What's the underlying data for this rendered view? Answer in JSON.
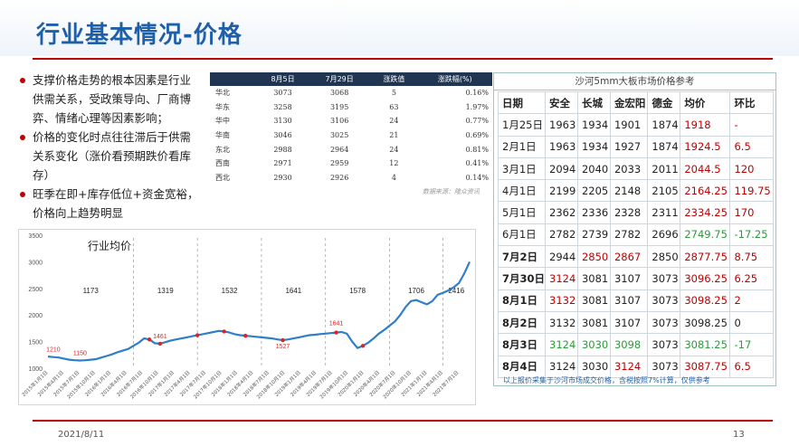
{
  "title": "行业基本情况-价格",
  "bullets": [
    "支撑价格走势的根本因素是行业供需关系，受政策导向、厂商博弈、情绪心理等因素影响；",
    "价格的变化时点往往滞后于供需关系变化（涨价看预期跌价看库存）",
    "旺季在即+库存低位+资金宽裕，价格向上趋势明显"
  ],
  "regional": {
    "headers": [
      "",
      "8月5日",
      "7月29日",
      "涨跌值",
      "涨跌幅(%)"
    ],
    "rows": [
      [
        "华北",
        "3073",
        "3068",
        "5",
        "0.16%"
      ],
      [
        "华东",
        "3258",
        "3195",
        "63",
        "1.97%"
      ],
      [
        "华中",
        "3130",
        "3106",
        "24",
        "0.77%"
      ],
      [
        "华南",
        "3046",
        "3025",
        "21",
        "0.69%"
      ],
      [
        "东北",
        "2988",
        "2964",
        "24",
        "0.81%"
      ],
      [
        "西南",
        "2971",
        "2959",
        "12",
        "0.41%"
      ],
      [
        "西北",
        "2930",
        "2926",
        "4",
        "0.14%"
      ]
    ],
    "source": "数据来源：隆众资讯"
  },
  "price_table": {
    "caption": "沙河5mm大板市场价格参考",
    "headers": [
      "日期",
      "安全",
      "长城",
      "金宏阳",
      "德金",
      "均价",
      "环比"
    ],
    "rows": [
      {
        "cells": [
          "1月25日",
          "1963",
          "1934",
          "1901",
          "1874",
          "1918",
          "-"
        ],
        "colors": [
          "",
          "",
          "",
          "",
          "",
          "red",
          "red"
        ]
      },
      {
        "cells": [
          "2月1日",
          "1963",
          "1934",
          "1927",
          "1874",
          "1924.5",
          "6.5"
        ],
        "colors": [
          "",
          "",
          "",
          "",
          "",
          "red",
          "red"
        ]
      },
      {
        "cells": [
          "3月1日",
          "2094",
          "2040",
          "2033",
          "2011",
          "2044.5",
          "120"
        ],
        "colors": [
          "",
          "",
          "",
          "",
          "",
          "red",
          "red"
        ]
      },
      {
        "cells": [
          "4月1日",
          "2199",
          "2205",
          "2148",
          "2105",
          "2164.25",
          "119.75"
        ],
        "colors": [
          "",
          "",
          "",
          "",
          "",
          "red",
          "red"
        ]
      },
      {
        "cells": [
          "5月1日",
          "2362",
          "2336",
          "2328",
          "2311",
          "2334.25",
          "170"
        ],
        "colors": [
          "",
          "",
          "",
          "",
          "",
          "red",
          "red"
        ]
      },
      {
        "cells": [
          "6月1日",
          "2782",
          "2739",
          "2782",
          "2696",
          "2749.75",
          "-17.25"
        ],
        "colors": [
          "",
          "",
          "",
          "",
          "",
          "green",
          "green"
        ]
      },
      {
        "cells": [
          "7月2日",
          "2944",
          "2850",
          "2867",
          "2850",
          "2877.75",
          "8.75"
        ],
        "colors": [
          "",
          "",
          "red",
          "red",
          "",
          "red",
          "red"
        ]
      },
      {
        "cells": [
          "7月30日",
          "3124",
          "3081",
          "3107",
          "3073",
          "3096.25",
          "6.25"
        ],
        "colors": [
          "",
          "red",
          "",
          "",
          "",
          "red",
          "red"
        ]
      },
      {
        "cells": [
          "8月1日",
          "3132",
          "3081",
          "3107",
          "3073",
          "3098.25",
          "2"
        ],
        "colors": [
          "",
          "red",
          "",
          "",
          "",
          "red",
          "red"
        ]
      },
      {
        "cells": [
          "8月2日",
          "3132",
          "3081",
          "3107",
          "3073",
          "3098.25",
          "0"
        ],
        "colors": [
          "",
          "",
          "",
          "",
          "",
          "",
          ""
        ]
      },
      {
        "cells": [
          "8月3日",
          "3124",
          "3030",
          "3098",
          "3073",
          "3081.25",
          "-17"
        ],
        "colors": [
          "",
          "green",
          "green",
          "green",
          "",
          "green",
          "green"
        ]
      },
      {
        "cells": [
          "8月4日",
          "3124",
          "3030",
          "3124",
          "3073",
          "3087.75",
          "6.5"
        ],
        "colors": [
          "",
          "",
          "",
          "red",
          "",
          "red",
          "red"
        ]
      }
    ],
    "note": "以上报价采集于沙河市场成交价格，含税按照7%计算，仅供参考",
    "colors": {
      "red": "#c00000",
      "green": "#2b9c39"
    }
  },
  "chart_data": {
    "type": "line",
    "title": "行业均价",
    "ylim": [
      1000,
      3500
    ],
    "yticks": [
      1000,
      1500,
      2000,
      2500,
      3000,
      3500
    ],
    "xticks": [
      "2015年1月1日",
      "2015年4月1日",
      "2015年7月1日",
      "2015年10月1日",
      "2016年1月1日",
      "2016年4月1日",
      "2016年7月1日",
      "2016年10月1日",
      "2017年1月1日",
      "2017年4月1日",
      "2017年7月1日",
      "2017年10月1日",
      "2018年1月1日",
      "2018年4月1日",
      "2018年7月1日",
      "2018年10月1日",
      "2019年1月1日",
      "2019年4月1日",
      "2019年7月1日",
      "2019年10月1日",
      "2020年1月1日",
      "2020年4月1日",
      "2020年7月1日",
      "2020年10月1日",
      "2021年1月1日",
      "2021年4月1日",
      "2021年7月1日"
    ],
    "series": [
      {
        "color": "#2e7ec9",
        "x": [
          0,
          1,
          2,
          3,
          4,
          5,
          6,
          7,
          8,
          9,
          10,
          11,
          12,
          13,
          14,
          15,
          16,
          17,
          18,
          19,
          20,
          21,
          22,
          23,
          24,
          25,
          26,
          27,
          28,
          29,
          30,
          31,
          32,
          33,
          34,
          35,
          36,
          37,
          38,
          39,
          40,
          41,
          42,
          43,
          44,
          45,
          46,
          47,
          48,
          49,
          50,
          51,
          52,
          53,
          54,
          55,
          56,
          57,
          58,
          59,
          60,
          61,
          62,
          63,
          64,
          65,
          66,
          67,
          68,
          69,
          70,
          71,
          72,
          73,
          74,
          75,
          76,
          77,
          78,
          79
        ],
        "values": [
          1220,
          1210,
          1200,
          1180,
          1160,
          1150,
          1145,
          1150,
          1160,
          1170,
          1200,
          1230,
          1260,
          1300,
          1330,
          1360,
          1420,
          1480,
          1560,
          1540,
          1470,
          1461,
          1490,
          1520,
          1540,
          1560,
          1580,
          1600,
          1620,
          1640,
          1660,
          1680,
          1700,
          1690,
          1670,
          1640,
          1620,
          1610,
          1600,
          1590,
          1580,
          1570,
          1560,
          1540,
          1527,
          1540,
          1560,
          1580,
          1600,
          1620,
          1630,
          1641,
          1650,
          1660,
          1670,
          1680,
          1650,
          1500,
          1380,
          1420,
          1480,
          1560,
          1650,
          1720,
          1800,
          1880,
          2000,
          2150,
          2260,
          2280,
          2240,
          2200,
          2260,
          2380,
          2416,
          2460,
          2520,
          2600,
          2780,
          3000
        ]
      }
    ],
    "markers": [
      {
        "i": 19,
        "label": ""
      },
      {
        "i": 21,
        "label": "1461"
      },
      {
        "i": 28,
        "label": ""
      },
      {
        "i": 33,
        "label": ""
      },
      {
        "i": 37,
        "label": ""
      },
      {
        "i": 44,
        "label": "1527"
      },
      {
        "i": 54,
        "label": "1641"
      },
      {
        "i": 59,
        "label": ""
      }
    ],
    "point_labels": [
      {
        "i": 1,
        "label": "1210"
      },
      {
        "i": 6,
        "label": "1150"
      }
    ],
    "periods": [
      "1173",
      "1319",
      "1532",
      "1641",
      "1578",
      "1706",
      "2416"
    ],
    "period_bounds": [
      0,
      16,
      28,
      40,
      52,
      64,
      74,
      79
    ]
  },
  "footer": {
    "date": "2021/8/11",
    "page": "13"
  }
}
